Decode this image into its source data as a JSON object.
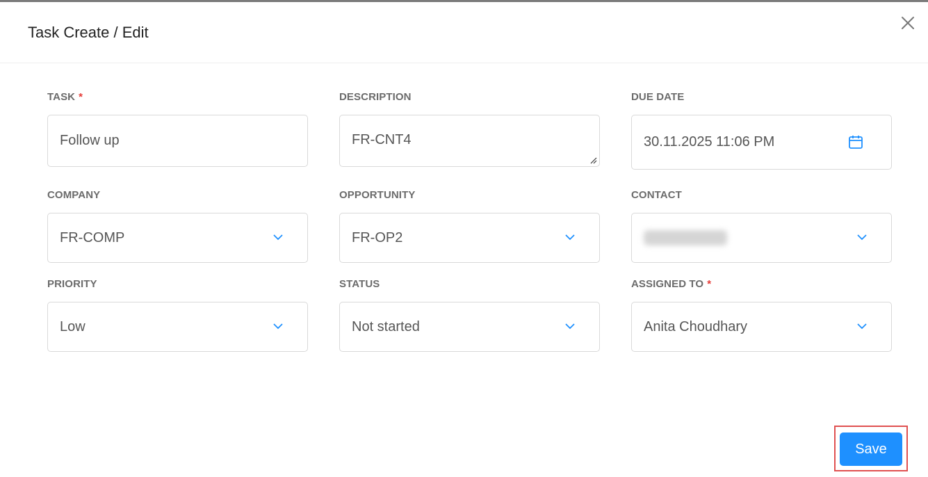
{
  "modal": {
    "title": "Task Create / Edit"
  },
  "fields": {
    "task": {
      "label": "TASK",
      "required_mark": "*",
      "value": "Follow up"
    },
    "description": {
      "label": "DESCRIPTION",
      "value": "FR-CNT4"
    },
    "due_date": {
      "label": "DUE DATE",
      "value": "30.11.2025 11:06 PM"
    },
    "company": {
      "label": "COMPANY",
      "value": "FR-COMP"
    },
    "opportunity": {
      "label": "OPPORTUNITY",
      "value": "FR-OP2"
    },
    "contact": {
      "label": "CONTACT",
      "value": ""
    },
    "priority": {
      "label": "PRIORITY",
      "value": "Low"
    },
    "status": {
      "label": "STATUS",
      "value": "Not started"
    },
    "assigned_to": {
      "label": "ASSIGNED TO",
      "required_mark": "*",
      "value": "Anita Choudhary"
    }
  },
  "actions": {
    "save_label": "Save"
  },
  "icons": {
    "close": "close-icon",
    "calendar": "calendar-icon",
    "dropdown": "chevron-down-icon"
  },
  "colors": {
    "accent": "#1e90ff",
    "required": "#e53935",
    "highlight_border": "#e05050"
  }
}
